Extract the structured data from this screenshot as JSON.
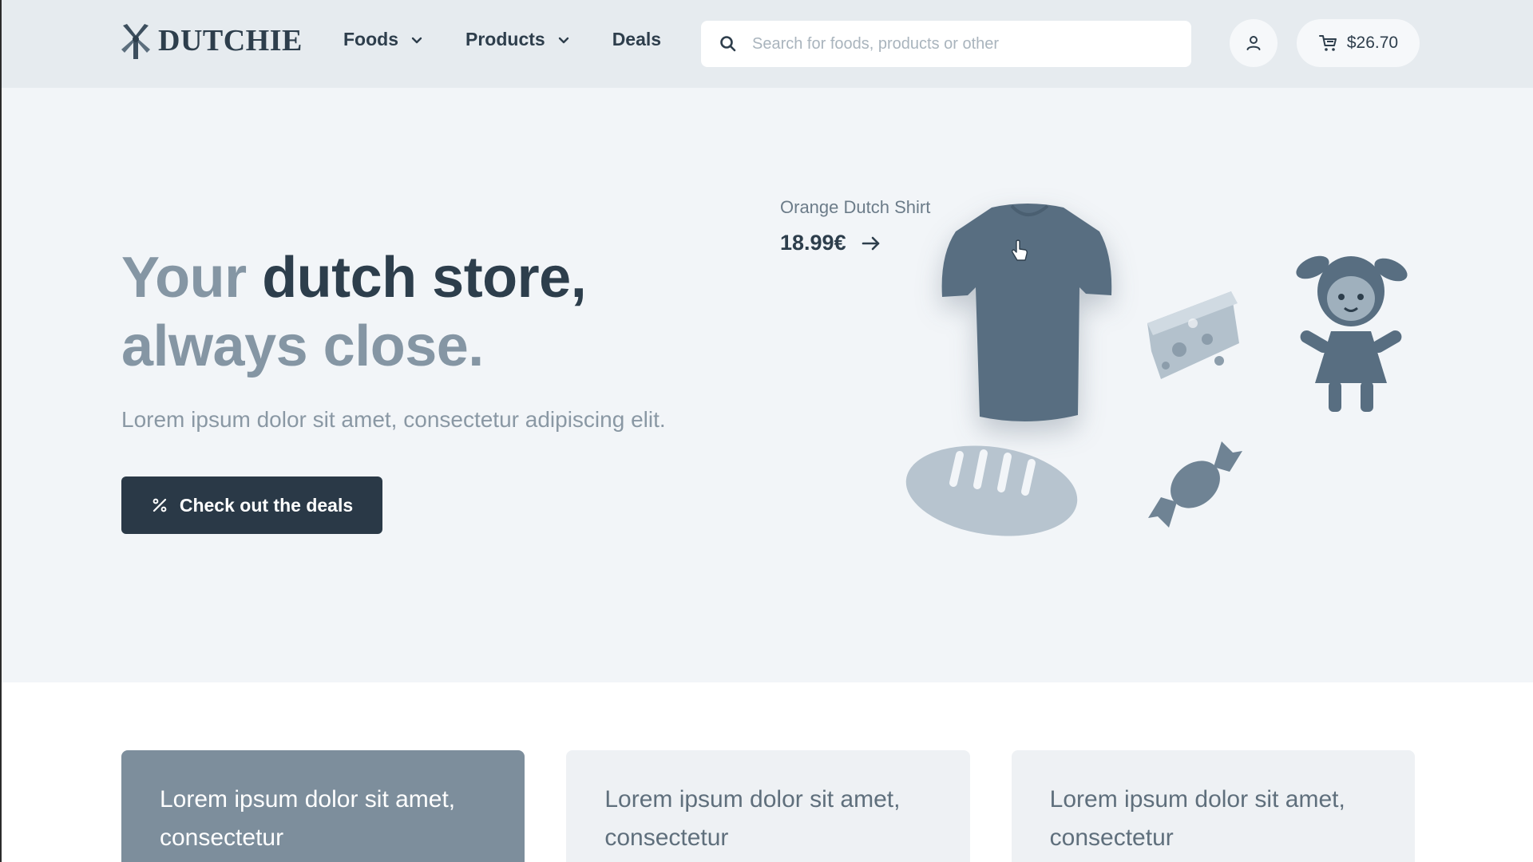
{
  "brand": {
    "name": "DUTCHIE"
  },
  "nav": {
    "items": [
      {
        "label": "Foods",
        "has_dropdown": true
      },
      {
        "label": "Products",
        "has_dropdown": true
      },
      {
        "label": "Deals",
        "has_dropdown": false
      }
    ]
  },
  "search": {
    "placeholder": "Search for foods, products or other",
    "value": ""
  },
  "cart": {
    "total": "$26.70"
  },
  "hero": {
    "headline_part1": "Your",
    "headline_part2": "dutch store,",
    "headline_part3": "always close.",
    "subtitle": "Lorem ipsum dolor sit amet, consectetur adipiscing elit.",
    "cta_label": "Check out the deals"
  },
  "featured_product": {
    "name": "Orange Dutch Shirt",
    "price": "18.99€"
  },
  "cards": [
    {
      "text": "Lorem ipsum dolor sit amet, consectetur",
      "style": "dark"
    },
    {
      "text": "Lorem ipsum dolor sit amet, consectetur",
      "style": "light"
    },
    {
      "text": "Lorem ipsum dolor sit amet, consectetur",
      "style": "light"
    }
  ],
  "colors": {
    "header_bg": "#e6ebef",
    "hero_bg": "#f2f5f8",
    "primary_dark": "#2a3947",
    "muted_text": "#8596a4",
    "illustration_dark": "#5a6f82",
    "illustration_light": "#b7c4cf"
  },
  "icons": {
    "logo": "windmill-icon",
    "dropdown": "chevron-down-icon",
    "search": "search-icon",
    "account": "user-icon",
    "cart": "cart-icon",
    "cta": "percent-icon",
    "price_arrow": "arrow-right-icon"
  }
}
